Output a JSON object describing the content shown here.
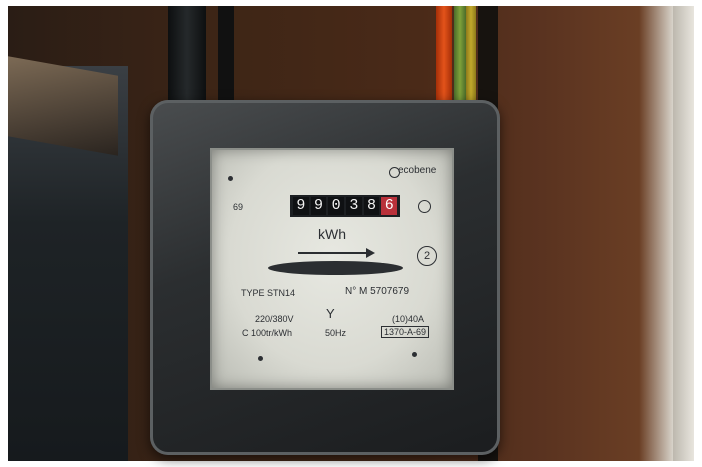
{
  "meter": {
    "brand": "ecobene",
    "reading_digits": [
      "9",
      "9",
      "0",
      "3",
      "8",
      "6"
    ],
    "red_digits_from": 5,
    "unit": "kWh",
    "small_number": "69",
    "class_badge": "2",
    "type_label": "TYPE STN14",
    "serial": "N° M 5707679",
    "voltage": "220/380V",
    "constant": "C 100tr/kWh",
    "frequency": "50Hz",
    "current": "(10)40A",
    "model_code": "1370-A-69"
  }
}
